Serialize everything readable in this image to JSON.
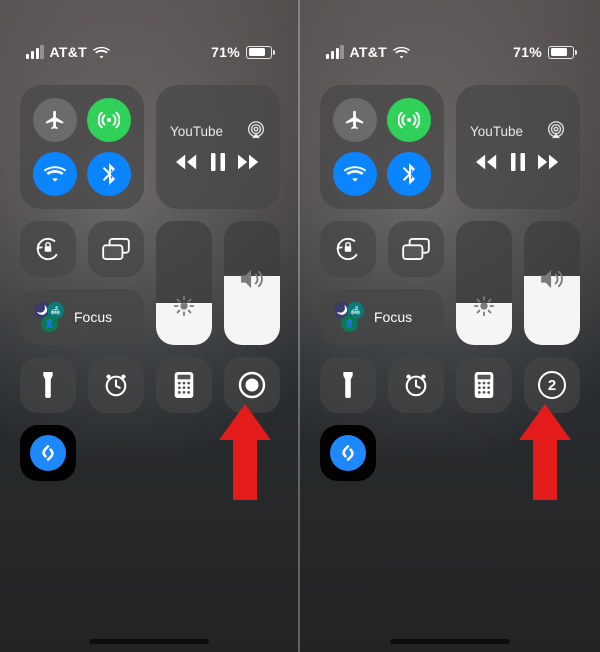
{
  "status": {
    "carrier": "AT&T",
    "battery_pct": "71%"
  },
  "media": {
    "now_playing_label": "YouTube"
  },
  "focus": {
    "label": "Focus"
  },
  "screen_record": {
    "countdown_value": "2"
  }
}
